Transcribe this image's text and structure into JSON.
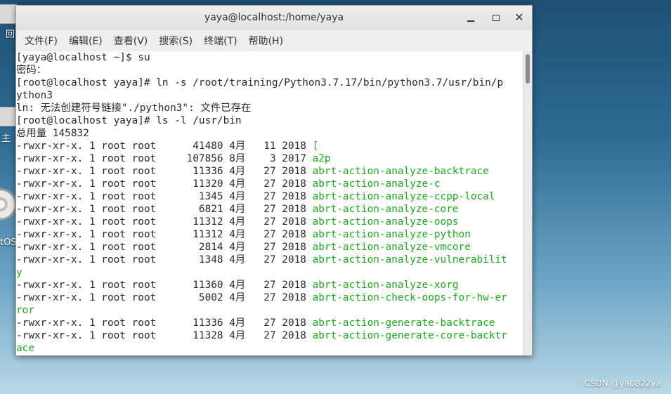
{
  "desktop": {
    "labels": [
      {
        "text": "回"
      },
      {
        "text": "主"
      },
      {
        "text": "tOS"
      }
    ],
    "watermark": "CSDN @ya0822ya"
  },
  "window": {
    "title": "yaya@localhost:/home/yaya",
    "menu": [
      "文件(F)",
      "编辑(E)",
      "查看(V)",
      "搜索(S)",
      "终端(T)",
      "帮助(H)"
    ]
  },
  "terminal": {
    "lines": [
      {
        "text": "[yaya@localhost ~]$ su",
        "green": ""
      },
      {
        "text": "密码：",
        "green": ""
      },
      {
        "text": "[root@localhost yaya]# ln -s /root/training/Python3.7.17/bin/python3.7/usr/bin/p",
        "green": ""
      },
      {
        "text": "ython3",
        "green": ""
      },
      {
        "text": "ln: 无法创建符号链接\"./python3\": 文件已存在",
        "green": ""
      },
      {
        "text": "[root@localhost yaya]# ls -l /usr/bin",
        "green": ""
      },
      {
        "text": "总用量 145832",
        "green": ""
      },
      {
        "text": "-rwxr-xr-x. 1 root root      41480 4月   11 2018 ",
        "green": "["
      },
      {
        "text": "-rwxr-xr-x. 1 root root     107856 8月    3 2017 ",
        "green": "a2p"
      },
      {
        "text": "-rwxr-xr-x. 1 root root      11336 4月   27 2018 ",
        "green": "abrt-action-analyze-backtrace"
      },
      {
        "text": "-rwxr-xr-x. 1 root root      11320 4月   27 2018 ",
        "green": "abrt-action-analyze-c"
      },
      {
        "text": "-rwxr-xr-x. 1 root root       1345 4月   27 2018 ",
        "green": "abrt-action-analyze-ccpp-local"
      },
      {
        "text": "-rwxr-xr-x. 1 root root       6821 4月   27 2018 ",
        "green": "abrt-action-analyze-core"
      },
      {
        "text": "-rwxr-xr-x. 1 root root      11312 4月   27 2018 ",
        "green": "abrt-action-analyze-oops"
      },
      {
        "text": "-rwxr-xr-x. 1 root root      11312 4月   27 2018 ",
        "green": "abrt-action-analyze-python"
      },
      {
        "text": "-rwxr-xr-x. 1 root root       2814 4月   27 2018 ",
        "green": "abrt-action-analyze-vmcore"
      },
      {
        "text": "-rwxr-xr-x. 1 root root       1348 4月   27 2018 ",
        "green": "abrt-action-analyze-vulnerabilit"
      },
      {
        "text": "",
        "green": "y"
      },
      {
        "text": "-rwxr-xr-x. 1 root root      11360 4月   27 2018 ",
        "green": "abrt-action-analyze-xorg"
      },
      {
        "text": "-rwxr-xr-x. 1 root root       5002 4月   27 2018 ",
        "green": "abrt-action-check-oops-for-hw-er"
      },
      {
        "text": "",
        "green": "ror"
      },
      {
        "text": "-rwxr-xr-x. 1 root root      11336 4月   27 2018 ",
        "green": "abrt-action-generate-backtrace"
      },
      {
        "text": "-rwxr-xr-x. 1 root root      11328 4月   27 2018 ",
        "green": "abrt-action-generate-core-backtr"
      },
      {
        "text": "",
        "green": "ace"
      }
    ]
  },
  "colors": {
    "exec_green": "#1ca91c",
    "terminal_bg": "#ffffff",
    "text": "#2a2a2a"
  }
}
